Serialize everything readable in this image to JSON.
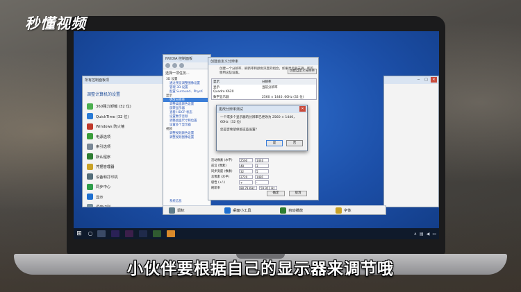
{
  "watermark": {
    "logo_text": "秒懂视频"
  },
  "caption": "小伙伴要根据自己的显示器来调节哦",
  "control_panel": {
    "title": "所有控制面板项",
    "heading": "调整计算机的设置",
    "items": [
      {
        "label": "360强力卸载 (32 位)",
        "icon": "uninstall-icon",
        "color": "#4caf50"
      },
      {
        "label": "QuickTime (32 位)",
        "icon": "quicktime-icon",
        "color": "#2a7bd6"
      },
      {
        "label": "Windows 防火墙",
        "icon": "firewall-icon",
        "color": "#c0392b"
      },
      {
        "label": "电源选项",
        "icon": "power-icon",
        "color": "#3a9d3a"
      },
      {
        "label": "索引选项",
        "icon": "index-icon",
        "color": "#7a8896"
      },
      {
        "label": "默认程序",
        "icon": "default-programs-icon",
        "color": "#2e7d32"
      },
      {
        "label": "凭据管理器",
        "icon": "credential-icon",
        "color": "#c9a227"
      },
      {
        "label": "设备和打印机",
        "icon": "printer-icon",
        "color": "#546e7a"
      },
      {
        "label": "同步中心",
        "icon": "sync-icon",
        "color": "#2e9d4a"
      },
      {
        "label": "显示",
        "icon": "display-icon",
        "color": "#1e6fd0"
      },
      {
        "label": "语音识别",
        "icon": "speech-icon",
        "color": "#78909c"
      }
    ]
  },
  "nvidia_panel": {
    "title": "NVIDIA 控制面板",
    "task_heading": "选择一项任务...",
    "tasks": [
      {
        "label": "3D 设置",
        "type": "cat"
      },
      {
        "label": "通过预览调整图像设置",
        "type": "item"
      },
      {
        "label": "管理 3D 设置",
        "type": "item"
      },
      {
        "label": "配置 Surround、PhysX",
        "type": "item"
      },
      {
        "label": "显示",
        "type": "cat"
      },
      {
        "label": "更改分辨率",
        "type": "sel"
      },
      {
        "label": "调整桌面颜色设置",
        "type": "item"
      },
      {
        "label": "旋转显示器",
        "type": "item"
      },
      {
        "label": "查看 HDCP 状态",
        "type": "item"
      },
      {
        "label": "设置数字音频",
        "type": "item"
      },
      {
        "label": "调整桌面尺寸和位置",
        "type": "item"
      },
      {
        "label": "设置多个显示器",
        "type": "item"
      },
      {
        "label": "视频",
        "type": "cat"
      },
      {
        "label": "调整视频颜色设置",
        "type": "item"
      },
      {
        "label": "调整视频图像设置",
        "type": "item"
      }
    ],
    "system_info": "系统信息"
  },
  "custom_resolution": {
    "title": "创建自定义分辨率",
    "description": "创建一个分辨率、刷新率和颜色深度的组合，如果显示器支持，即可使用这些设置。",
    "create_button": "创建自定义分辨率",
    "table_headers": [
      "显示",
      "分辨率"
    ],
    "rows": [
      {
        "col1": "显示",
        "col2": "当前分辨率"
      },
      {
        "col1": "Quadro K620",
        "col2": ""
      },
      {
        "col1": "数字显示器",
        "col2": "2560 × 1440, 60Hz (32 位)"
      }
    ],
    "params": [
      {
        "label": "活动像素 (水平)",
        "v1": "2560",
        "v2": "1440"
      },
      {
        "label": "前沿 (像素)",
        "v1": "48",
        "v2": "3"
      },
      {
        "label": "同步宽度 (像素)",
        "v1": "32",
        "v2": "5"
      },
      {
        "label": "总像素 (水平)",
        "v1": "2720",
        "v2": "1481"
      },
      {
        "label": "极性 (+/-)",
        "v1": "+",
        "v2": "-"
      },
      {
        "label": "刷新率",
        "v1": "88.79 KHz",
        "v2": "59.951 Hz"
      }
    ],
    "ok_button": "确定",
    "cancel_button": "取消"
  },
  "confirm_dialog": {
    "title": "更改分辨率测试",
    "line1": "一个或多个显示器的分辨率已更改为 2560 × 1440，60Hz（32 位）",
    "line2": "您是否希望保留这些设置？",
    "yes_button": "是",
    "no_button": "否"
  },
  "bottom_items": [
    {
      "label": "鼠标",
      "color": "#607d8b"
    },
    {
      "label": "桌面小工具",
      "color": "#1e6fd0"
    },
    {
      "label": "自动播放",
      "color": "#2e7d32"
    },
    {
      "label": "字体",
      "color": "#c9a227"
    }
  ]
}
